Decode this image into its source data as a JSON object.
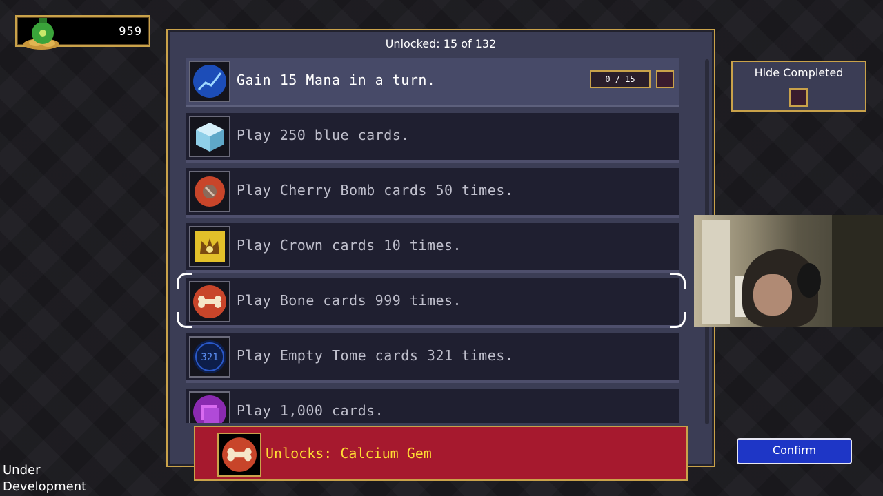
{
  "currency": {
    "amount": "959",
    "icon": "money-bag-icon"
  },
  "panel": {
    "unlocked_text": "Unlocked: 15 of 132",
    "achievements": [
      {
        "label": "Gain 15 Mana in a turn.",
        "icon": "mana-chart-icon",
        "progress": "0 / 15",
        "active": true
      },
      {
        "label": "Play 250 blue cards.",
        "icon": "blue-cube-icon"
      },
      {
        "label": "Play Cherry Bomb cards 50 times.",
        "icon": "cherry-bomb-icon"
      },
      {
        "label": "Play Crown cards 10 times.",
        "icon": "crown-icon"
      },
      {
        "label": "Play Bone cards 999 times.",
        "icon": "bone-icon",
        "selected": true
      },
      {
        "label": "Play Empty Tome cards 321 times.",
        "icon": "empty-tome-icon",
        "icon_text": "321"
      },
      {
        "label": "Play 1,000 cards.",
        "icon": "cards-stack-icon"
      }
    ]
  },
  "unlock_banner": {
    "text": "Unlocks: Calcium Gem",
    "icon": "calcium-gem-icon"
  },
  "hide_completed": {
    "label": "Hide Completed",
    "checked": false
  },
  "confirm": {
    "label": "Confirm"
  },
  "footer": {
    "line1": "Under",
    "line2": "Development"
  },
  "colors": {
    "gold_border": "#c9a24a",
    "panel_bg": "#3b3d55",
    "banner_red": "#a6192e",
    "confirm_blue": "#1e36c6",
    "banner_text": "#ffdd33"
  }
}
